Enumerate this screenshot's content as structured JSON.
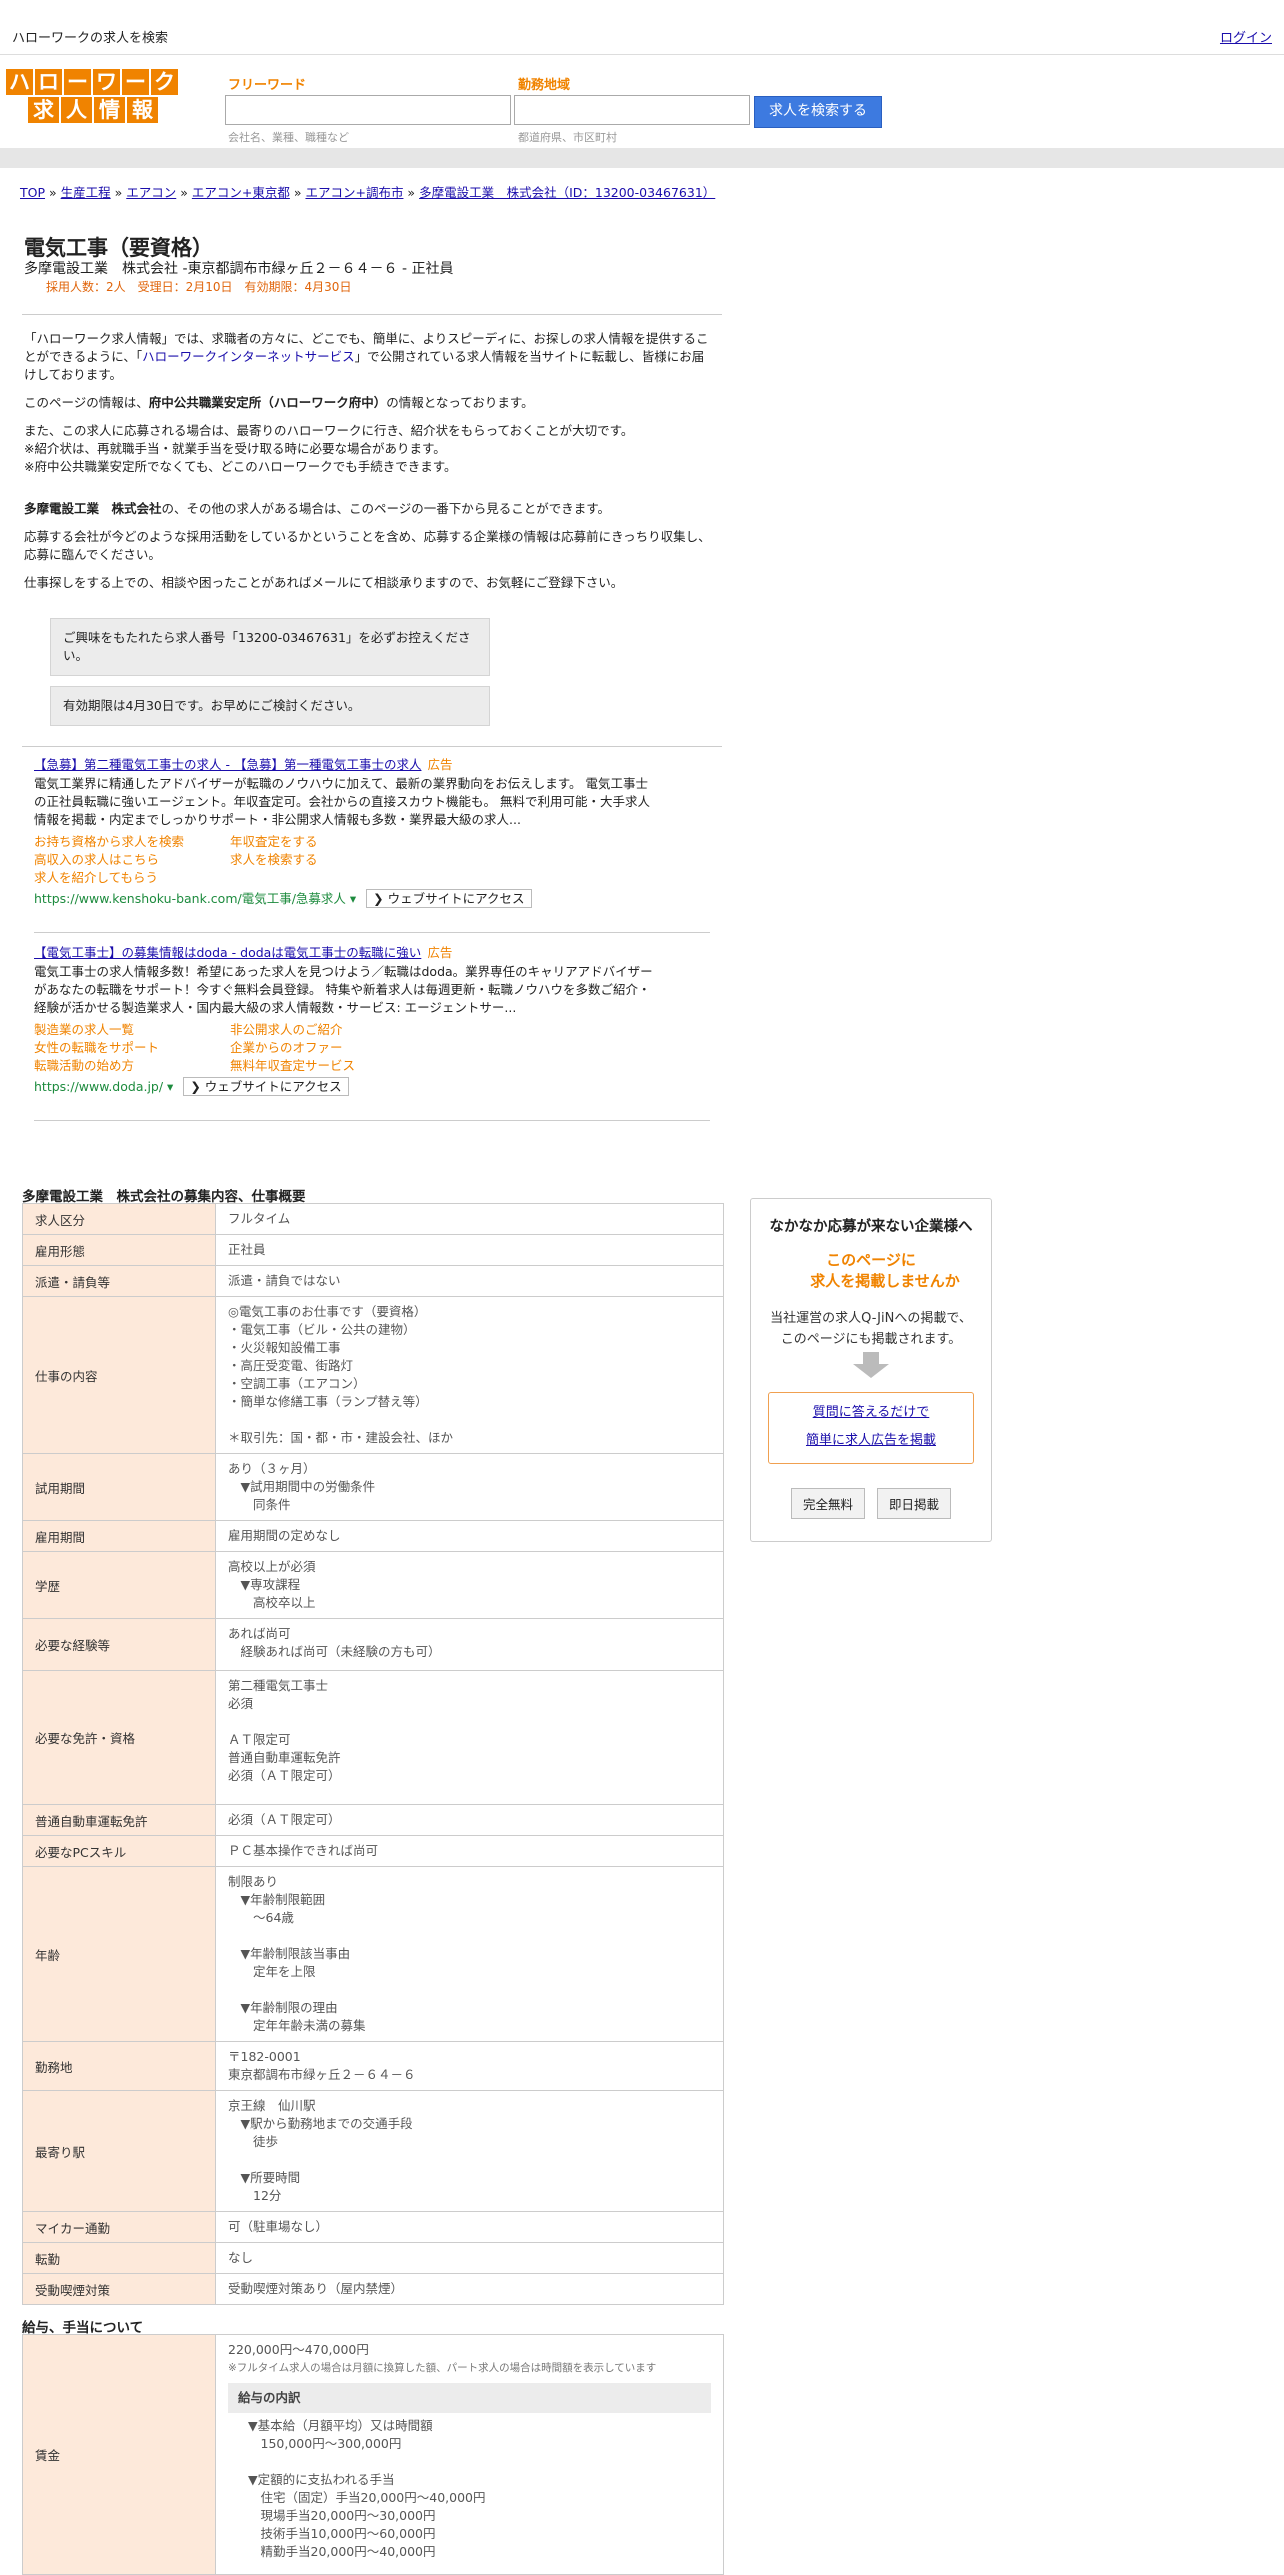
{
  "topbar": {
    "site_name": "ハローワークの求人を検索",
    "login": "ログイン"
  },
  "logo": {
    "row1": [
      "ハ",
      "ロ",
      "ー",
      "ワ",
      "ー",
      "ク"
    ],
    "row2": [
      "求",
      "人",
      "情",
      "報"
    ],
    "brand_color": "#f08300"
  },
  "search": {
    "keyword_label": "フリーワード",
    "keyword_placeholder": "会社名、業種、職種など",
    "area_label": "勤務地域",
    "area_placeholder": "都道府県、市区町村",
    "button": "求人を検索する"
  },
  "breadcrumb": [
    "TOP",
    "生産工程",
    "エアコン",
    "エアコン+東京都",
    "エアコン+調布市",
    "多摩電設工業　株式会社（ID：13200-03467631）"
  ],
  "job": {
    "title": "電気工事（要資格）",
    "subtitle": "多摩電設工業　株式会社 -東京都調布市緑ヶ丘２－６４－６ - 正社員",
    "meta": "採用人数：2人　受理日：2月10日　有効期限：4月30日"
  },
  "intro": {
    "p1_a": "「ハローワーク求人情報」では、求職者の方々に、どこでも、簡単に、よりスピーディに、お探しの求人情報を提供することができるように、「",
    "p1_link": "ハローワークインターネットサービス",
    "p1_b": "」で公開されている求人情報を当サイトに転載し、皆様にお届けしております。",
    "p2_a": "このページの情報は、",
    "p2_bold": "府中公共職業安定所（ハローワーク府中）",
    "p2_b": "の情報となっております。",
    "p3": "また、この求人に応募される場合は、最寄りのハローワークに行き、紹介状をもらっておくことが大切です。",
    "p4": "※紹介状は、再就職手当・就業手当を受け取る時に必要な場合があります。",
    "p5": "※府中公共職業安定所でなくても、どこのハローワークでも手続きできます。",
    "p6_bold": "多摩電設工業　株式会社",
    "p6": "の、その他の求人がある場合は、このページの一番下から見ることができます。",
    "p7": "応募する会社が今どのような採用活動をしているかということを含め、応募する企業様の情報は応募前にきっちり収集し、応募に臨んでください。",
    "p8": "仕事探しをする上での、相談や困ったことがあればメールにて相談承りますので、お気軽にご登録下さい。"
  },
  "notes": {
    "n1": "ご興味をもたれたら求人番号「13200-03467631」を必ずお控えください。",
    "n2": "有効期限は4月30日です。お早めにご検討ください。"
  },
  "ads": [
    {
      "title": "【急募】第二種電気工事士の求人 - 【急募】第一種電気工事士の求人",
      "tag": "広告",
      "desc": "電気工業界に精通したアドバイザーが転職のノウハウに加えて、最新の業界動向をお伝えします。 電気工事士の正社員転職に強いエージェント。年収査定可。会社からの直接スカウト機能も。 無料で利用可能・大手求人情報を掲載・内定までしっかりサポート・非公開求人情報も多数・業界最大級の求人...",
      "links": [
        "お持ち資格から求人を検索",
        "年収査定をする",
        "高収入の求人はこちら",
        "求人を検索する",
        "求人を紹介してもらう"
      ],
      "url": "https://www.kenshoku-bank.com/電気工事/急募求人",
      "visit": "ウェブサイトにアクセス"
    },
    {
      "title": "【電気工事士】の募集情報はdoda - dodaは電気工事士の転職に強い",
      "tag": "広告",
      "desc": "電気工事士の求人情報多数！希望にあった求人を見つけよう／転職はdoda。業界専任のキャリアアドバイザーがあなたの転職をサポート！今すぐ無料会員登録。 特集や新着求人は毎週更新・転職ノウハウを多数ご紹介・経験が活かせる製造業求人・国内最大級の求人情報数・サービス: エージェントサー...",
      "links": [
        "製造業の求人一覧",
        "非公開求人のご紹介",
        "女性の転職をサポート",
        "企業からのオファー",
        "転職活動の始め方",
        "無料年収査定サービス"
      ],
      "url": "https://www.doda.jp/",
      "visit": "ウェブサイトにアクセス"
    }
  ],
  "detail": {
    "title": "多摩電設工業　株式会社の募集内容、仕事概要",
    "rows": [
      {
        "k": "求人区分",
        "v": "フルタイム"
      },
      {
        "k": "雇用形態",
        "v": "正社員"
      },
      {
        "k": "派遣・請負等",
        "v": "派遣・請負ではない"
      },
      {
        "k": "仕事の内容",
        "v": "◎電気工事のお仕事です（要資格）\n・電気工事（ビル・公共の建物）\n・火災報知設備工事\n・高圧受変電、街路灯\n・空調工事（エアコン）\n・簡単な修繕工事（ランプ替え等）\n\n＊取引先：国・都・市・建設会社、ほか"
      },
      {
        "k": "試用期間",
        "v": "あり（３ヶ月）\n　▼試用期間中の労働条件\n　　同条件"
      },
      {
        "k": "雇用期間",
        "v": "雇用期間の定めなし"
      },
      {
        "k": "学歴",
        "v": "高校以上が必須\n　▼専攻課程\n　　高校卒以上"
      },
      {
        "k": "必要な経験等",
        "v": "あれば尚可\n　経験あれば尚可（未経験の方も可）"
      },
      {
        "k": "必要な免許・資格",
        "v": "第二種電気工事士\n必須\n\nＡＴ限定可\n普通自動車運転免許\n必須（ＡＴ限定可）"
      },
      {
        "k": "普通自動車運転免許",
        "v": "必須（ＡＴ限定可）"
      },
      {
        "k": "必要なPCスキル",
        "v": "ＰＣ基本操作できれば尚可"
      },
      {
        "k": "年齢",
        "v": "制限あり\n　▼年齢制限範囲\n　　〜64歳\n\n　▼年齢制限該当事由\n　　定年を上限\n\n　▼年齢制限の理由\n　　定年年齢未満の募集"
      },
      {
        "k": "勤務地",
        "v": "〒182-0001\n東京都調布市緑ヶ丘２－６４－６"
      },
      {
        "k": "最寄り駅",
        "v": "京王線　仙川駅\n　▼駅から勤務地までの交通手段\n　　徒歩\n\n　▼所要時間\n　　12分"
      },
      {
        "k": "マイカー通勤",
        "v": "可（駐車場なし）"
      },
      {
        "k": "転勤",
        "v": "なし"
      },
      {
        "k": "受動喫煙対策",
        "v": "受動喫煙対策あり（屋内禁煙）"
      }
    ]
  },
  "pay": {
    "title": "給与、手当について",
    "label": "賃金",
    "range": "220,000円〜470,000円",
    "note": "※フルタイム求人の場合は月額に換算した額、パート求人の場合は時間額を表示しています",
    "breakdown_title": "給与の内訳",
    "breakdown": "▼基本給（月額平均）又は時間額\n　150,000円〜300,000円\n\n▼定額的に支払われる手当\n　住宅（固定）手当20,000円〜40,000円\n　現場手当20,000円〜30,000円\n　技術手当10,000円〜60,000円\n　精勤手当20,000円〜40,000円"
  },
  "side": {
    "heading": "なかなか応募が来ない企業様へ",
    "catch1": "このページに",
    "catch2": "求人を掲載しませんか",
    "body1": "当社運営の求人Q-JiNへの掲載で、",
    "body2": "このページにも掲載されます。",
    "link1": "質問に答えるだけで",
    "link2": "簡単に求人広告を掲載",
    "btn1": "完全無料",
    "btn2": "即日掲載"
  }
}
